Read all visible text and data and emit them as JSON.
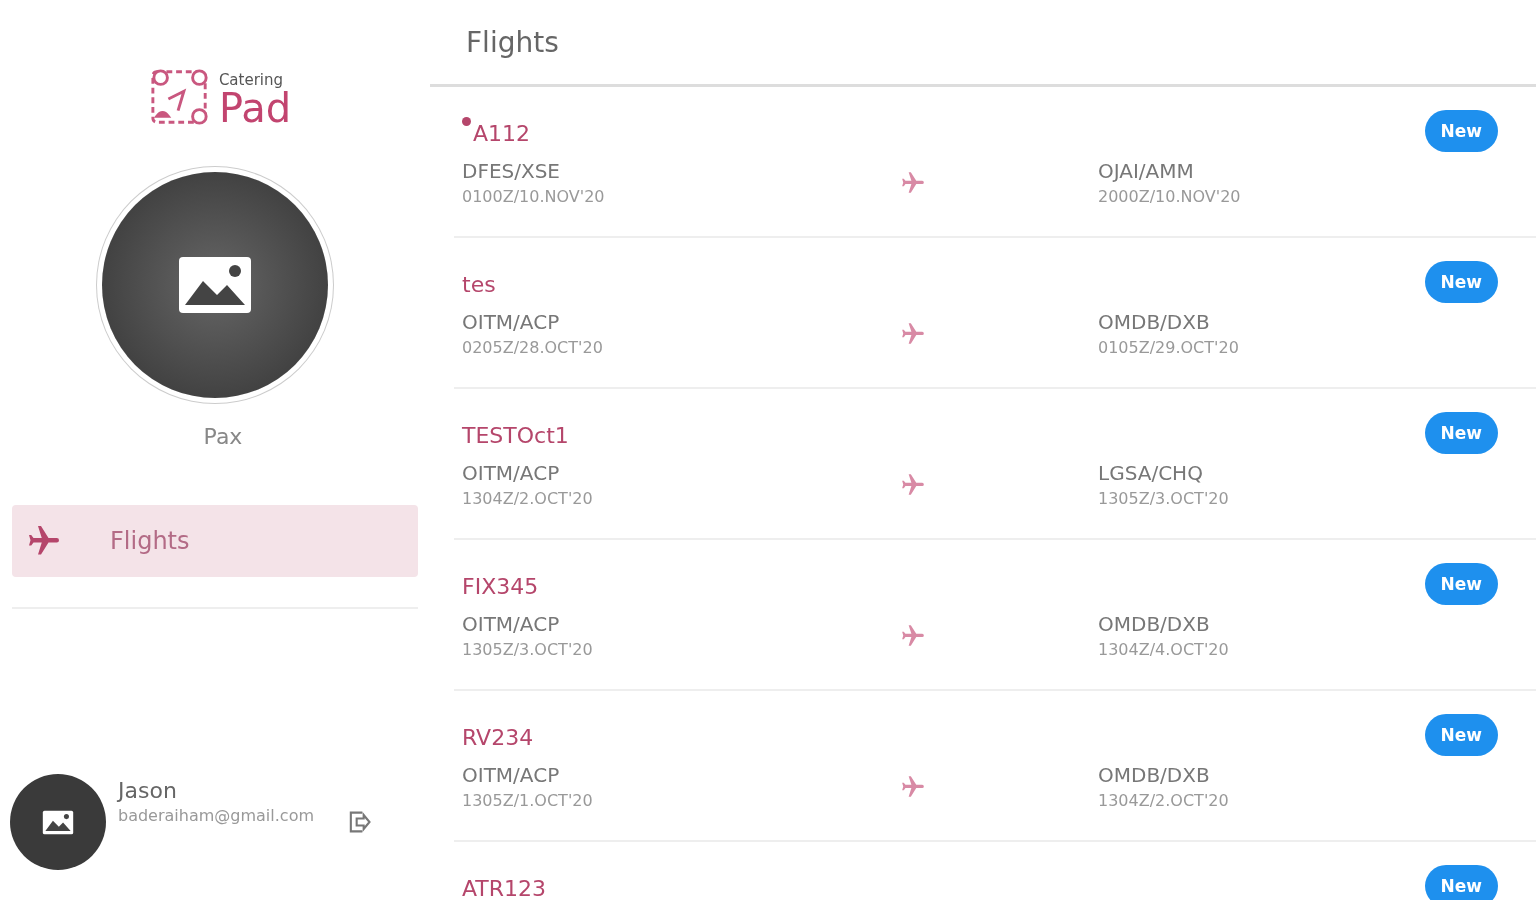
{
  "logo": {
    "small": "Catering",
    "large": "Pad"
  },
  "profile": {
    "name": "Pax"
  },
  "nav": [
    {
      "label": "Flights",
      "selected": true
    }
  ],
  "user": {
    "name": "Jason",
    "email": "baderaiham@gmail.com"
  },
  "header": {
    "title": "Flights"
  },
  "flights": [
    {
      "code": "A112",
      "unread": true,
      "status": "New",
      "from": "DFES/XSE",
      "from_time": "0100Z/10.NOV'20",
      "to": "OJAI/AMM",
      "to_time": "2000Z/10.NOV'20"
    },
    {
      "code": "tes",
      "unread": false,
      "status": "New",
      "from": "OITM/ACP",
      "from_time": "0205Z/28.OCT'20",
      "to": "OMDB/DXB",
      "to_time": "0105Z/29.OCT'20"
    },
    {
      "code": "TESTOct1",
      "unread": false,
      "status": "New",
      "from": "OITM/ACP",
      "from_time": "1304Z/2.OCT'20",
      "to": "LGSA/CHQ",
      "to_time": "1305Z/3.OCT'20"
    },
    {
      "code": "FIX345",
      "unread": false,
      "status": "New",
      "from": "OITM/ACP",
      "from_time": "1305Z/3.OCT'20",
      "to": "OMDB/DXB",
      "to_time": "1304Z/4.OCT'20"
    },
    {
      "code": "RV234",
      "unread": false,
      "status": "New",
      "from": "OITM/ACP",
      "from_time": "1305Z/1.OCT'20",
      "to": "OMDB/DXB",
      "to_time": "1304Z/2.OCT'20"
    },
    {
      "code": "ATR123",
      "unread": false,
      "status": "New"
    }
  ]
}
